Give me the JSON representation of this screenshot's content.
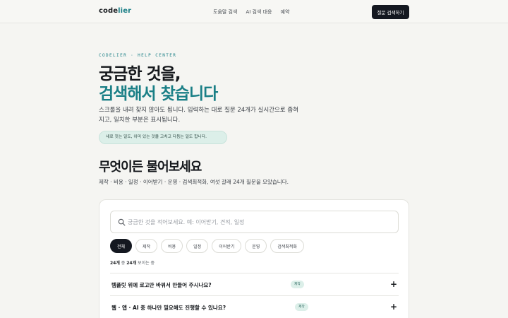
{
  "header": {
    "logo_main": "code",
    "logo_accent": "lier",
    "nav": [
      "도움말 검색",
      "AI 검색 대응",
      "예약"
    ],
    "cta_label": "질문 검색하기"
  },
  "hero": {
    "eyebrow": "CODELIER · HELP CENTER",
    "title_line1": "궁금한 것을,",
    "title_line2": "검색해서 찾습니다",
    "description": "스크롤을 내려 찾지 않아도 됩니다. 입력하는 대로 질문 24개가 실시간으로 좁혀지고, 일치한 부분은 표시됩니다.",
    "note": "새로 짓는 일도, 이미 있는 것을 고치고 다듬는 일도 합니다."
  },
  "section": {
    "title": "무엇이든 물어보세요",
    "description": "제작 · 비용 · 일정 · 이어받기 · 운영 · 검색최적화, 여섯 갈래 24개 질문을 모았습니다."
  },
  "search": {
    "placeholder": "궁금한 것을 적어보세요. 예: 이어받기, 견적, 일정",
    "value": ""
  },
  "filters": {
    "chips": [
      "전체",
      "제작",
      "비용",
      "일정",
      "이어받기",
      "운영",
      "검색최적화"
    ],
    "active_index": 0
  },
  "results": {
    "shown": "24개",
    "of_text": "중",
    "total": "24개",
    "suffix": "보이는 중"
  },
  "faq": [
    {
      "question": "템플릿 위에 로고만 바꿔서 만들어 주시나요?",
      "tag": "제작"
    },
    {
      "question": "웹 · 앱 · AI 중 하나만 필요해도 진행할 수 있나요?",
      "tag": "제작"
    }
  ],
  "colors": {
    "accent": "#1a7f86",
    "dark": "#141820",
    "tag_bg": "#dcefe9"
  }
}
